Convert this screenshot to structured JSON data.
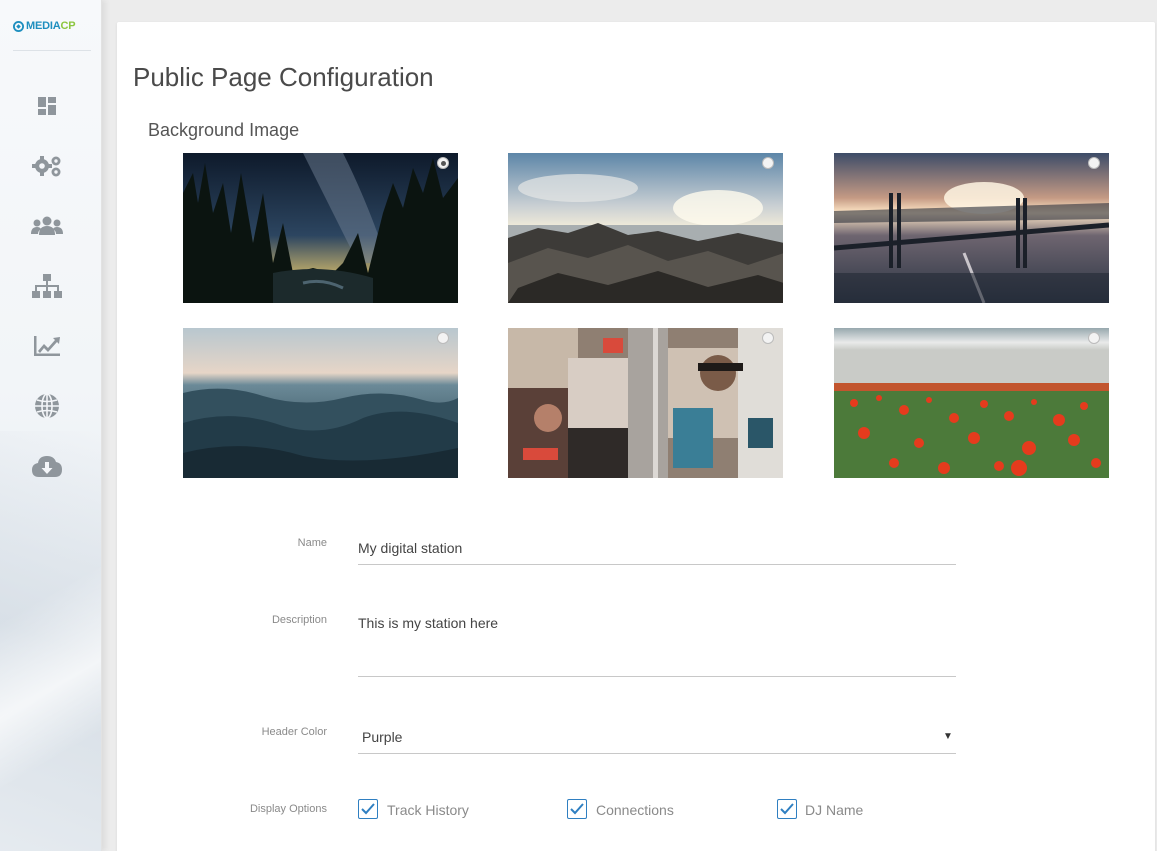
{
  "brand": {
    "logo_media": "MEDIA",
    "logo_cp": "CP",
    "colors": {
      "media": "#1e8fbf",
      "cp": "#8cc63f"
    }
  },
  "sidebar": {
    "items": [
      {
        "icon": "dashboard-icon"
      },
      {
        "icon": "gears-icon"
      },
      {
        "icon": "users-icon"
      },
      {
        "icon": "sitemap-icon"
      },
      {
        "icon": "chart-icon"
      },
      {
        "icon": "globe-icon"
      },
      {
        "icon": "cloud-download-icon"
      }
    ]
  },
  "page": {
    "title": "Public Page Configuration",
    "background_section_title": "Background Image",
    "backgrounds": [
      {
        "name": "night-forest",
        "selected": true
      },
      {
        "name": "rocky-coast",
        "selected": false
      },
      {
        "name": "bridge-sunset",
        "selected": false
      },
      {
        "name": "ocean-waves",
        "selected": false
      },
      {
        "name": "poster-collage",
        "selected": false
      },
      {
        "name": "poppy-field",
        "selected": false
      }
    ]
  },
  "form": {
    "name_label": "Name",
    "name_value": "My digital station",
    "description_label": "Description",
    "description_value": "This is my station here",
    "header_color_label": "Header Color",
    "header_color_value": "Purple",
    "display_options_label": "Display Options",
    "display_options": [
      {
        "label": "Track History",
        "checked": true
      },
      {
        "label": "Connections",
        "checked": true
      },
      {
        "label": "DJ Name",
        "checked": true
      }
    ]
  }
}
